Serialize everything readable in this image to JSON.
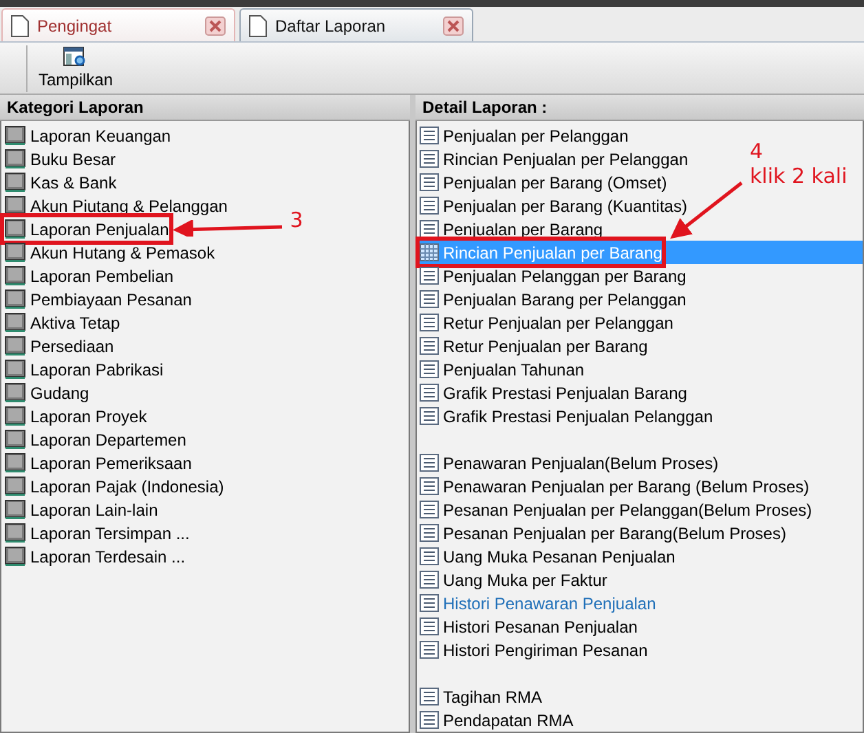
{
  "tabs": [
    {
      "label": "Pengingat",
      "selected": false
    },
    {
      "label": "Daftar Laporan",
      "selected": true
    }
  ],
  "toolbar": {
    "buttons": [
      {
        "label": "Tampilkan"
      }
    ]
  },
  "category_panel": {
    "title": "Kategori Laporan",
    "items": [
      {
        "label": "Laporan Keuangan",
        "selected": false
      },
      {
        "label": "Buku Besar",
        "selected": false
      },
      {
        "label": "Kas & Bank",
        "selected": false
      },
      {
        "label": "Akun Piutang & Pelanggan",
        "selected": false
      },
      {
        "label": "Laporan Penjualan",
        "selected": false,
        "callout": {
          "number": "3"
        }
      },
      {
        "label": "Akun Hutang & Pemasok",
        "selected": false
      },
      {
        "label": "Laporan Pembelian",
        "selected": false
      },
      {
        "label": "Pembiayaan Pesanan",
        "selected": false
      },
      {
        "label": "Aktiva Tetap",
        "selected": false
      },
      {
        "label": "Persediaan",
        "selected": false
      },
      {
        "label": "Laporan Pabrikasi",
        "selected": false
      },
      {
        "label": "Gudang",
        "selected": false
      },
      {
        "label": "Laporan Proyek",
        "selected": false
      },
      {
        "label": "Laporan Departemen",
        "selected": false
      },
      {
        "label": "Laporan Pemeriksaan",
        "selected": false
      },
      {
        "label": "Laporan Pajak (Indonesia)",
        "selected": false
      },
      {
        "label": "Laporan Lain-lain",
        "selected": false
      },
      {
        "label": "Laporan Tersimpan ...",
        "selected": false
      },
      {
        "label": "Laporan Terdesain ...",
        "selected": false
      }
    ]
  },
  "detail_panel": {
    "title": "Detail Laporan :",
    "groups": [
      {
        "items": [
          {
            "label": "Penjualan per Pelanggan",
            "selected": false,
            "hovered": false
          },
          {
            "label": "Rincian Penjualan per Pelanggan",
            "selected": false,
            "hovered": false
          },
          {
            "label": "Penjualan per Barang (Omset)",
            "selected": false,
            "hovered": false
          },
          {
            "label": "Penjualan per Barang (Kuantitas)",
            "selected": false,
            "hovered": false
          },
          {
            "label": "Penjualan per Barang",
            "selected": false,
            "hovered": false
          },
          {
            "label": "Rincian Penjualan per Barang",
            "selected": true,
            "hovered": false,
            "callout": {
              "number": "4",
              "note": "klik 2 kali"
            }
          },
          {
            "label": "Penjualan Pelanggan per Barang",
            "selected": false,
            "hovered": false
          },
          {
            "label": "Penjualan Barang per Pelanggan",
            "selected": false,
            "hovered": false
          },
          {
            "label": "Retur Penjualan per Pelanggan",
            "selected": false,
            "hovered": false
          },
          {
            "label": "Retur Penjualan per Barang",
            "selected": false,
            "hovered": false
          },
          {
            "label": "Penjualan Tahunan",
            "selected": false,
            "hovered": false
          },
          {
            "label": "Grafik Prestasi Penjualan Barang",
            "selected": false,
            "hovered": false
          },
          {
            "label": "Grafik Prestasi Penjualan Pelanggan",
            "selected": false,
            "hovered": false
          }
        ]
      },
      {
        "items": [
          {
            "label": "Penawaran Penjualan(Belum Proses)",
            "selected": false,
            "hovered": false
          },
          {
            "label": "Penawaran Penjualan per Barang (Belum Proses)",
            "selected": false,
            "hovered": false
          },
          {
            "label": "Pesanan Penjualan per Pelanggan(Belum Proses)",
            "selected": false,
            "hovered": false
          },
          {
            "label": "Pesanan Penjualan per Barang(Belum Proses)",
            "selected": false,
            "hovered": false
          },
          {
            "label": "Uang Muka Pesanan Penjualan",
            "selected": false,
            "hovered": false
          },
          {
            "label": "Uang Muka per Faktur",
            "selected": false,
            "hovered": false
          },
          {
            "label": "Histori Penawaran Penjualan",
            "selected": false,
            "hovered": true
          },
          {
            "label": "Histori Pesanan Penjualan",
            "selected": false,
            "hovered": false
          },
          {
            "label": "Histori Pengiriman Pesanan",
            "selected": false,
            "hovered": false
          }
        ]
      },
      {
        "items": [
          {
            "label": "Tagihan RMA",
            "selected": false,
            "hovered": false
          },
          {
            "label": "Pendapatan RMA",
            "selected": false,
            "hovered": false
          }
        ]
      }
    ]
  }
}
